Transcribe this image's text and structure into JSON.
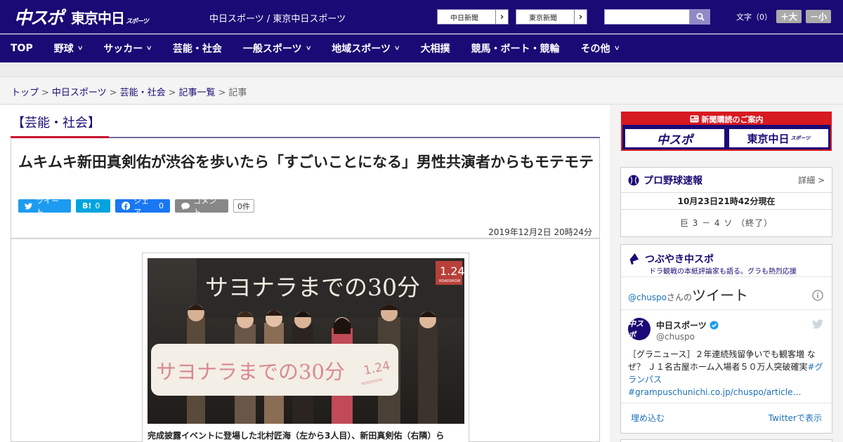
{
  "header": {
    "logo_chuspo": "中スポ",
    "logo_tokyo": "東京中日",
    "logo_tokyo_small": "スポーツ",
    "site_links": "中日スポーツ / 東京中日スポーツ",
    "paper_buttons": [
      "中日新聞",
      "東京新聞"
    ],
    "search": {
      "placeholder": ""
    },
    "fontsize_label": "文字（0）",
    "fontsize_up": "＋大",
    "fontsize_down": "－小"
  },
  "nav": {
    "items": [
      {
        "label": "TOP",
        "has_menu": false
      },
      {
        "label": "野球",
        "has_menu": true
      },
      {
        "label": "サッカー",
        "has_menu": true
      },
      {
        "label": "芸能・社会",
        "has_menu": false
      },
      {
        "label": "一般スポーツ",
        "has_menu": true
      },
      {
        "label": "地域スポーツ",
        "has_menu": true
      },
      {
        "label": "大相撲",
        "has_menu": false
      },
      {
        "label": "競馬・ボート・競輪",
        "has_menu": false
      },
      {
        "label": "その他",
        "has_menu": true
      }
    ]
  },
  "breadcrumb": {
    "items": [
      "トップ",
      "中日スポーツ",
      "芸能・社会",
      "記事一覧"
    ],
    "current": "記事",
    "separator": ">"
  },
  "article": {
    "section": "【芸能・社会】",
    "headline": "ムキムキ新田真剣佑が渋谷を歩いたら「すごいことになる」男性共演者からもモテモテ",
    "share": {
      "tweet": "ツイート",
      "hatena_icon": "B!",
      "hatena_count": "0",
      "facebook": "シェア",
      "facebook_count": "0",
      "comment": "コメント",
      "comment_count": "0件"
    },
    "date": "2019年12月2日 20時24分",
    "photo": {
      "screen_text": "サヨナラまでの30分",
      "screen_date": "1.24",
      "screen_sub": "ROADSHOW",
      "banner_text": "サヨナラまでの30分",
      "banner_date": "1.24",
      "banner_sub": "ROADSHOW",
      "caption": "完成披露イベントに登場した北村匠海（左から3人目）、新田真剣佑（右隣）ら"
    }
  },
  "sidebar": {
    "subscribe": {
      "header": "新聞購読のご案内",
      "logos": [
        "中スポ",
        "東京中日"
      ],
      "logo_small": "スポーツ"
    },
    "baseball": {
      "title": "プロ野球速報",
      "detail": "詳細 >",
      "time": "10月23日21時42分現在",
      "score": "巨 3 － 4 ソ （終了）"
    },
    "tweets": {
      "title": "つぶやき中スポ",
      "subtitle": "ドラ観戦の本紙評論家も語る。グラも熱烈応援",
      "header_handle": "@chuspo",
      "header_suffix": "さんの",
      "header_big": "ツイート",
      "account_name": "中日スポーツ",
      "avatar_text": "中スポ",
      "account_handle": "@chuspo",
      "tweet_text": "［グラニュース］２年連続残留争いでも観客増 なぜ？ Ｊ１名古屋ホーム入場者５０万人突破確実",
      "tweet_links": "#グランパス #grampuschunichi.co.jp/chuspo/article…",
      "embed": "埋め込む",
      "view_on_twitter": "Twitterで表示"
    }
  },
  "colors": {
    "brand": "#1a0a75",
    "accent_red": "#c8102e",
    "twitter": "#1d9bf0",
    "facebook": "#1877f2",
    "hatena": "#00a4de"
  }
}
